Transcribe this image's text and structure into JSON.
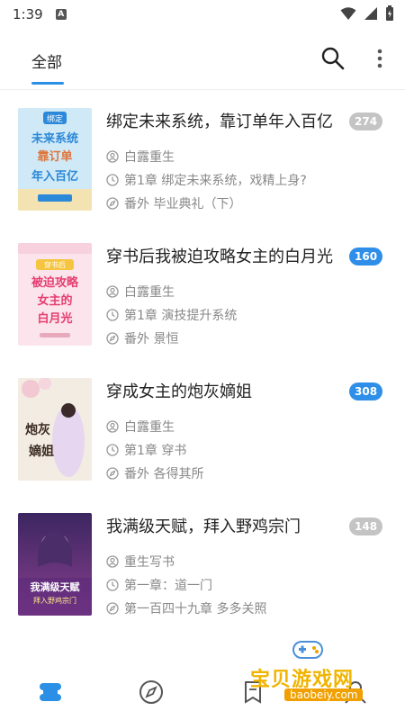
{
  "status_bar": {
    "time": "1:39",
    "notification": "A"
  },
  "header": {
    "tab_all": "全部"
  },
  "books": [
    {
      "title": "绑定未来系统，靠订单年入百亿",
      "count": "274",
      "count_style": "grey",
      "author": "白露重生",
      "latest_chapter": "第1章 绑定未来系统，戏精上身?",
      "last_read": "番外 毕业典礼（下）",
      "cover_text": [
        "绑定",
        "未来系统",
        "靠订单",
        "年入百亿"
      ]
    },
    {
      "title": "穿书后我被迫攻略女主的白月光",
      "count": "160",
      "count_style": "blue",
      "author": "白露重生",
      "latest_chapter": "第1章 演技提升系统",
      "last_read": "番外 景恒",
      "cover_text": [
        "穿书后",
        "被迫攻略",
        "女主的",
        "白月光"
      ]
    },
    {
      "title": "穿成女主的炮灰嫡姐",
      "count": "308",
      "count_style": "blue",
      "author": "白露重生",
      "latest_chapter": "第1章 穿书",
      "last_read": "番外 各得其所",
      "cover_text": [
        "炮灰",
        "嫡姐"
      ]
    },
    {
      "title": "我满级天赋，拜入野鸡宗门",
      "count": "148",
      "count_style": "grey",
      "author": "重生写书",
      "latest_chapter": "第一章：道一门",
      "last_read": "第一百四十九章 多多关照",
      "cover_text": [
        "我满级天赋",
        "拜入野鸡宗门"
      ]
    }
  ],
  "watermark": {
    "text": "宝贝游戏网",
    "url": "baobeiy.com"
  },
  "colors": {
    "accent": "#2b8fe5",
    "badge_grey": "#c4c4c4",
    "badge_blue": "#2f8fe8"
  },
  "icons": {
    "search": "search-icon",
    "more": "more-vert-icon",
    "author": "person-icon",
    "chapter": "clock-icon",
    "last": "compass-icon"
  }
}
